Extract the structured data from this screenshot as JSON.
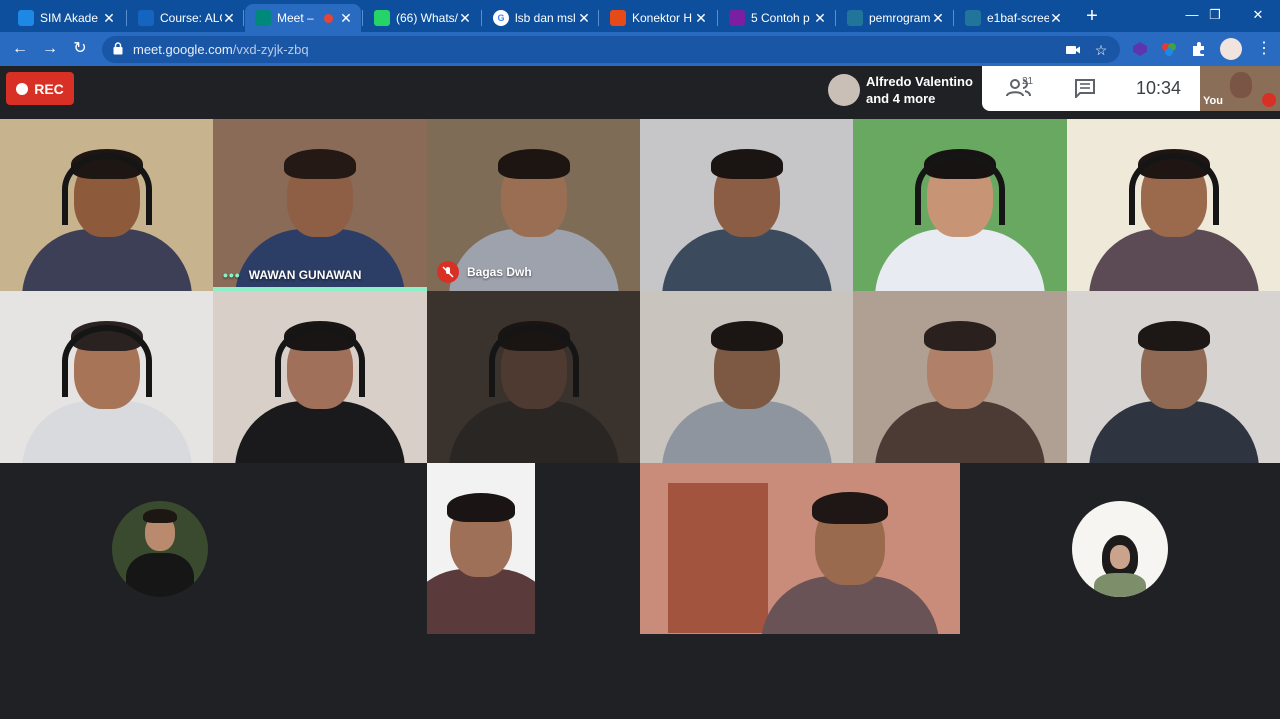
{
  "browser": {
    "tabs": [
      {
        "title": "SIM Akade",
        "favicon": "sim-icon",
        "color": "#1e88e5"
      },
      {
        "title": "Course: ALG",
        "favicon": "course-icon",
        "color": "#1565c0"
      },
      {
        "title": "Meet –",
        "favicon": "meet-icon",
        "color": "#00897b",
        "active": true,
        "recording": true
      },
      {
        "title": "(66) Whats/",
        "favicon": "whatsapp-icon",
        "color": "#25d366"
      },
      {
        "title": "lsb dan msl",
        "favicon": "google-icon",
        "color": "#ffffff"
      },
      {
        "title": "Konektor H",
        "favicon": "konektor-icon",
        "color": "#e64a19"
      },
      {
        "title": "5 Contoh p",
        "favicon": "contoh-icon",
        "color": "#7b1fa2"
      },
      {
        "title": "pemrogram",
        "favicon": "wordpress-icon",
        "color": "#21759b"
      },
      {
        "title": "e1baf-scree",
        "favicon": "wordpress-icon",
        "color": "#21759b"
      }
    ],
    "new_tab": "+",
    "window_controls": {
      "minimize": "—",
      "maximize": "❐",
      "close": "✕"
    },
    "url_host": "meet.google.com",
    "url_path": "/vxd-zyjk-zbq"
  },
  "meet": {
    "rec_label": "REC",
    "presenter_line1": "Alfredo Valentino",
    "presenter_line2": "and 4 more",
    "people_count": "21",
    "clock": "10:34",
    "self_label": "You"
  },
  "participants": [
    {
      "name": "",
      "bg": "#c7b48f",
      "skin": "#8d5a3b",
      "hair": "#1e1613",
      "shirt": "#3d3f56",
      "headphones": true
    },
    {
      "name": "WAWAN GUNAWAN",
      "bg": "#8a6b58",
      "skin": "#8f5f45",
      "hair": "#241914",
      "shirt": "#2c3e66",
      "speaking": true
    },
    {
      "name": "Bagas Dwh",
      "bg": "#7e6c57",
      "skin": "#9a6e52",
      "hair": "#1c1512",
      "shirt": "#9ea2ad",
      "muted": true
    },
    {
      "name": "",
      "bg": "#c6c6c8",
      "skin": "#8a5d44",
      "hair": "#1a1413",
      "shirt": "#3b4a5c"
    },
    {
      "name": "",
      "bg": "#69a861",
      "skin": "#c79475",
      "hair": "#171313",
      "shirt": "#e8ebf2",
      "headphones": true
    },
    {
      "name": "",
      "bg": "#efe9d9",
      "skin": "#9b6a4c",
      "hair": "#1f1614",
      "shirt": "#5c4b54",
      "headphones": true
    },
    {
      "name": "",
      "bg": "#e6e4e2",
      "skin": "#a77457",
      "hair": "#2a2220",
      "shirt": "#d8dadd",
      "headphones": true
    },
    {
      "name": "",
      "bg": "#d7cfc8",
      "skin": "#a0705a",
      "hair": "#1a1515",
      "shirt": "#1a1a1c",
      "headphones": true
    },
    {
      "name": "",
      "bg": "#3a322d",
      "skin": "#4e3a30",
      "hair": "#1a1412",
      "shirt": "#2a2623",
      "headphones": true
    },
    {
      "name": "",
      "bg": "#c9c4bd",
      "skin": "#7d5944",
      "hair": "#1b1514",
      "shirt": "#8e959f"
    },
    {
      "name": "",
      "bg": "#b09f93",
      "skin": "#b08068",
      "hair": "#2a201d",
      "shirt": "#4c3a34"
    },
    {
      "name": "",
      "bg": "#d6d3d1",
      "skin": "#8f6954",
      "hair": "#1d1715",
      "shirt": "#2e3540"
    }
  ],
  "bottom_row": [
    {
      "kind": "avatar",
      "bg": "#3a4a2e"
    },
    {
      "kind": "video",
      "bg": "#f2f2f2",
      "skin": "#9f7058",
      "hair": "#1a1414",
      "shirt": "#5a3a3a"
    },
    {
      "kind": "video",
      "bg": "#c98c7a",
      "skin": "#9a6a4e",
      "hair": "#1e1715",
      "shirt": "#6a5356"
    },
    {
      "kind": "avatar",
      "bg": "#f7f5f2"
    }
  ]
}
